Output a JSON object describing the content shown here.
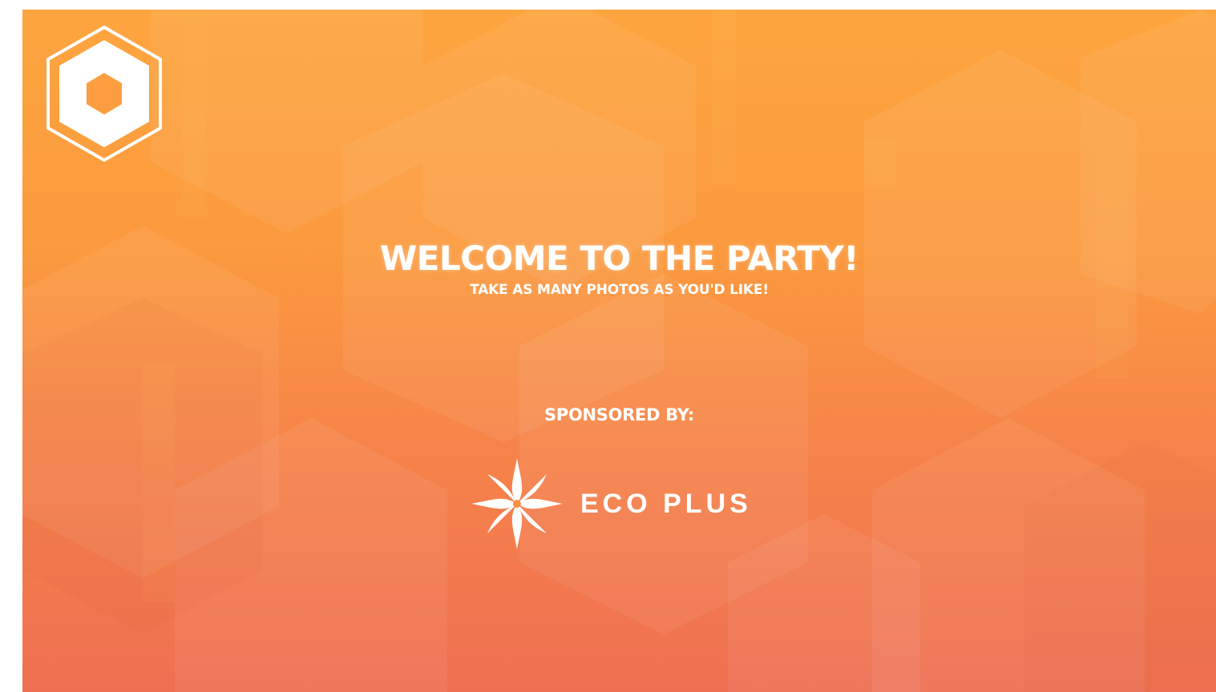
{
  "screen": {
    "headline": "WELCOME TO THE PARTY!",
    "subhead": "TAKE AS MANY PHOTOS AS YOU'D LIKE!",
    "sponsor_label": "SPONSORED BY:",
    "sponsor_name": "ECO PLUS",
    "brand_logo_icon": "hexagon-logo-icon",
    "sponsor_logo_icon": "star-compass-icon"
  },
  "colors": {
    "gradient_top": "#fda53f",
    "gradient_bottom": "#ef6f52",
    "text": "#ffffff"
  }
}
